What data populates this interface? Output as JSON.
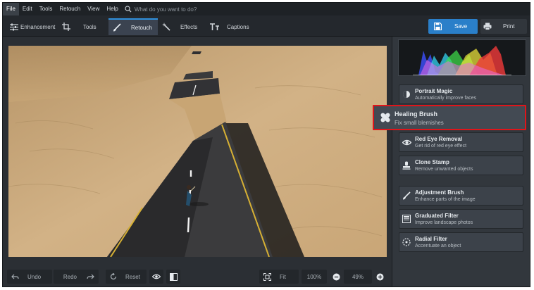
{
  "menu": [
    "File",
    "Edit",
    "Tools",
    "Retouch",
    "View",
    "Help"
  ],
  "search": {
    "placeholder": "What do you want to do?"
  },
  "tabs": {
    "enhancement": "Enhancement",
    "tools": "Tools",
    "retouch": "Retouch",
    "effects": "Effects",
    "captions": "Captions"
  },
  "actions": {
    "save": "Save",
    "print": "Print"
  },
  "panel": {
    "items": [
      {
        "title": "Portrait Magic",
        "subtitle": "Automatically improve faces"
      },
      {
        "title": "Healing Brush",
        "subtitle": "Fix small blemishes"
      },
      {
        "title": "Red Eye Removal",
        "subtitle": "Get rid of red eye effect"
      },
      {
        "title": "Clone Stamp",
        "subtitle": "Remove unwanted objects"
      },
      {
        "title": "Adjustment Brush",
        "subtitle": "Enhance parts of the image"
      },
      {
        "title": "Graduated Filter",
        "subtitle": "Improve landscape photos"
      },
      {
        "title": "Radial Filter",
        "subtitle": "Accentuate an object"
      }
    ]
  },
  "bottom": {
    "undo": "Undo",
    "redo": "Redo",
    "reset": "Reset",
    "fit": "Fit",
    "zoom100": "100%",
    "zoom_value": "49%"
  },
  "colors": {
    "accent": "#2a7fc9",
    "highlight": "#e0151a",
    "active_tab_line": "#2f8fdc"
  }
}
